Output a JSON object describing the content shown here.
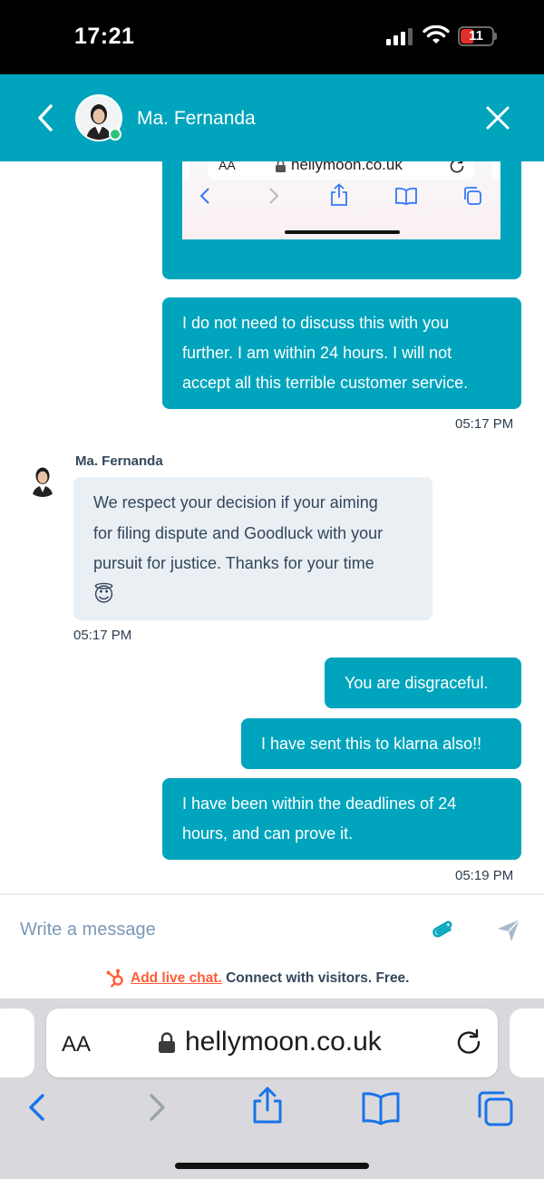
{
  "status_bar": {
    "time": "17:21",
    "battery": "11"
  },
  "header": {
    "agent_name": "Ma. Fernanda"
  },
  "embedded_screenshot": {
    "aa_label": "AA",
    "domain": "hellymoon.co.uk"
  },
  "messages": [
    {
      "sender": "visitor",
      "lines": [
        "I do not need to discuss this with you",
        "further. I am within 24 hours. I will not",
        "accept all this terrible customer service."
      ],
      "time": "05:17 PM"
    },
    {
      "sender": "agent",
      "name": "Ma. Fernanda",
      "lines": [
        "We respect your decision if your aiming",
        "for filing dispute and Goodluck with your",
        "pursuit for justice. Thanks for your time",
        "😇"
      ],
      "time": "05:17 PM"
    },
    {
      "sender": "visitor",
      "lines": [
        "You are disgraceful."
      ]
    },
    {
      "sender": "visitor",
      "lines": [
        "I have sent this to klarna also!!"
      ]
    },
    {
      "sender": "visitor",
      "lines": [
        "I have been within the deadlines of 24",
        "hours, and can prove it."
      ],
      "time": "05:19 PM"
    }
  ],
  "composer": {
    "placeholder": "Write a message",
    "promo_link": "Add live chat.",
    "promo_text": " Connect with visitors. Free."
  },
  "browser": {
    "aa_label": "AA",
    "domain": "hellymoon.co.uk"
  },
  "colors": {
    "accent": "#00a4bd",
    "agent_bubble": "#eaeff4",
    "promo_link": "#ff5c35",
    "online": "#2fc27a",
    "ios_blue": "#1a73e8"
  }
}
